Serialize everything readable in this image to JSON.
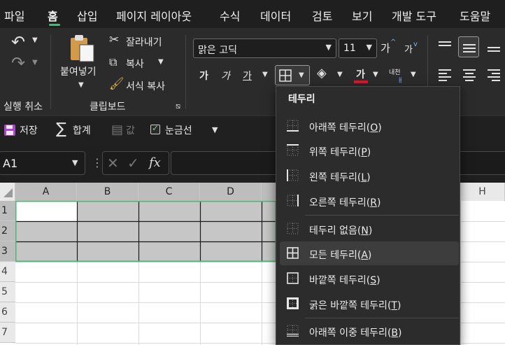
{
  "menu": {
    "tabs": [
      "파일",
      "홈",
      "삽입",
      "페이지 레이아웃",
      "수식",
      "데이터",
      "검토",
      "보기",
      "개발 도구",
      "도움말"
    ],
    "active_tab": "홈"
  },
  "ribbon": {
    "undo_group_label": "실행 취소",
    "clipboard": {
      "paste_label": "붙여넣기",
      "cut_label": "잘라내기",
      "copy_label": "복사",
      "format_painter_label": "서식 복사",
      "group_label": "클립보드"
    },
    "font": {
      "font_name": "맑은 고딕",
      "font_size": "11",
      "grow_label": "가",
      "shrink_label": "가",
      "bold_label": "가",
      "italic_label": "가",
      "underline_label": "가",
      "font_color_label": "가",
      "phonetic_label_top": "내천",
      "phonetic_label_bottom": "ㅐ",
      "font_color_bar": "#e8112d"
    }
  },
  "quick_access": {
    "save_label": "저장",
    "sum_label": "합계",
    "value_label": "값",
    "gridlines_label": "눈금선",
    "gridlines_checked": true
  },
  "formula_bar": {
    "name_box": "A1",
    "fx_label": "fx",
    "formula_value": ""
  },
  "grid": {
    "columns": [
      "A",
      "B",
      "C",
      "D",
      "H"
    ],
    "rows": [
      "1",
      "2",
      "3",
      "4",
      "5",
      "6",
      "7"
    ]
  },
  "border_dropdown": {
    "title": "테두리",
    "items": [
      {
        "label": "아래쪽 테두리",
        "key": "O",
        "icon": "bottom-border-icon"
      },
      {
        "label": "위쪽 테두리",
        "key": "P",
        "icon": "top-border-icon"
      },
      {
        "label": "왼쪽 테두리",
        "key": "L",
        "icon": "left-border-icon"
      },
      {
        "label": "오른쪽 테두리",
        "key": "R",
        "icon": "right-border-icon"
      },
      {
        "label": "테두리 없음",
        "key": "N",
        "icon": "no-border-icon"
      },
      {
        "label": "모든 테두리",
        "key": "A",
        "icon": "all-borders-icon"
      },
      {
        "label": "바깥쪽 테두리",
        "key": "S",
        "icon": "outside-borders-icon"
      },
      {
        "label": "굵은 바깥쪽 테두리",
        "key": "T",
        "icon": "thick-outside-borders-icon"
      },
      {
        "label": "아래쪽 이중 테두리",
        "key": "B",
        "icon": "bottom-double-border-icon"
      }
    ],
    "hovered": "모든 테두리"
  },
  "colors": {
    "accent_green": "#4fb477",
    "selection_fill": "#c6c6c6",
    "underline_red": "#e8112d"
  }
}
